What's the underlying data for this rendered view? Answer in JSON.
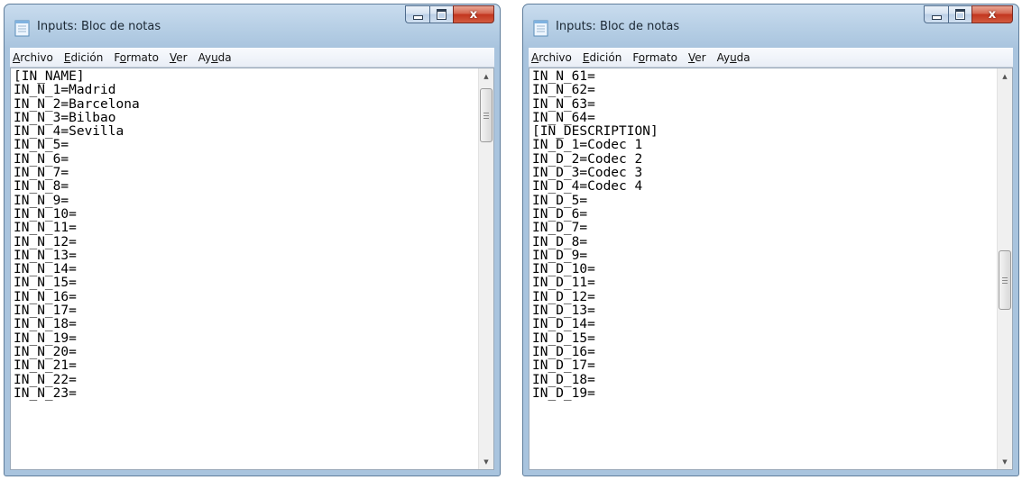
{
  "windows": [
    {
      "title": "Inputs: Bloc de notas",
      "menu": [
        {
          "key": "A",
          "rest": "rchivo"
        },
        {
          "pre": "",
          "key": "E",
          "rest": "dición"
        },
        {
          "pre": "F",
          "key": "o",
          "rest": "rmato"
        },
        {
          "pre": "",
          "key": "V",
          "rest": "er"
        },
        {
          "pre": "Ay",
          "key": "u",
          "rest": "da"
        }
      ],
      "lines": [
        "[IN_NAME]",
        "IN_N_1=Madrid",
        "IN_N_2=Barcelona",
        "IN_N_3=Bilbao",
        "IN_N_4=Sevilla",
        "IN_N_5=",
        "IN_N_6=",
        "IN_N_7=",
        "IN_N_8=",
        "IN_N_9=",
        "IN_N_10=",
        "IN_N_11=",
        "IN_N_12=",
        "IN_N_13=",
        "IN_N_14=",
        "IN_N_15=",
        "IN_N_16=",
        "IN_N_17=",
        "IN_N_18=",
        "IN_N_19=",
        "IN_N_20=",
        "IN_N_21=",
        "IN_N_22=",
        "IN_N_23="
      ],
      "scroll_position": 0.0,
      "buttons": {
        "close": "x"
      }
    },
    {
      "title": "Inputs: Bloc de notas",
      "menu": [
        {
          "key": "A",
          "rest": "rchivo"
        },
        {
          "pre": "",
          "key": "E",
          "rest": "dición"
        },
        {
          "pre": "F",
          "key": "o",
          "rest": "rmato"
        },
        {
          "pre": "",
          "key": "V",
          "rest": "er"
        },
        {
          "pre": "Ay",
          "key": "u",
          "rest": "da"
        }
      ],
      "lines": [
        "IN_N_61=",
        "IN_N_62=",
        "IN_N_63=",
        "IN_N_64=",
        "[IN_DESCRIPTION]",
        "IN_D_1=Codec 1",
        "IN_D_2=Codec 2",
        "IN_D_3=Codec 3",
        "IN_D_4=Codec 4",
        "IN_D_5=",
        "IN_D_6=",
        "IN_D_7=",
        "IN_D_8=",
        "IN_D_9=",
        "IN_D_10=",
        "IN_D_11=",
        "IN_D_12=",
        "IN_D_13=",
        "IN_D_14=",
        "IN_D_15=",
        "IN_D_16=",
        "IN_D_17=",
        "IN_D_18=",
        "IN_D_19="
      ],
      "scroll_position": 0.45,
      "buttons": {
        "close": "x"
      }
    }
  ],
  "icons": {
    "app": "notepad-icon",
    "minimize": "minimize-icon",
    "maximize": "maximize-icon",
    "close": "close-icon",
    "scroll_up": "scroll-up-arrow-icon",
    "scroll_down": "scroll-down-arrow-icon",
    "grip": "scrollbar-grip-icon"
  },
  "colors": {
    "titlebar": "#b4cde4",
    "close_button": "#c2361f",
    "text": "#000000",
    "background": "#ffffff"
  }
}
